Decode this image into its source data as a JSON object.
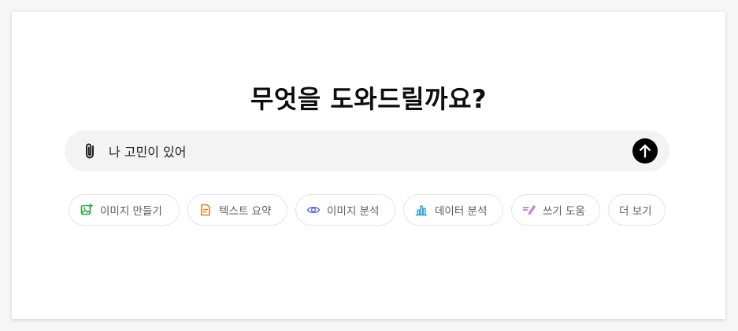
{
  "heading": "무엇을 도와드릴까요?",
  "composer": {
    "value": "나 고민이 있어",
    "attach_icon": "paperclip-icon",
    "send_icon": "arrow-up-icon"
  },
  "chips": [
    {
      "label": "이미지 만들기",
      "icon": "image-create-icon",
      "color": "#2ea24a"
    },
    {
      "label": "텍스트 요약",
      "icon": "document-icon",
      "color": "#e2822b"
    },
    {
      "label": "이미지 분석",
      "icon": "eye-icon",
      "color": "#6b6fd4"
    },
    {
      "label": "데이터 분석",
      "icon": "bar-chart-icon",
      "color": "#3aa6d9"
    },
    {
      "label": "쓰기 도움",
      "icon": "pen-icon",
      "color": "#b56bd0"
    },
    {
      "label": "더 보기",
      "icon": "",
      "color": ""
    }
  ]
}
